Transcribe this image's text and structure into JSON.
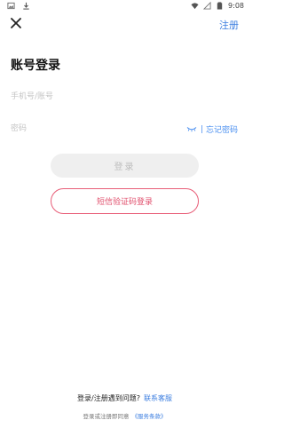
{
  "status_bar": {
    "time": "9:08",
    "left_icons": [
      "image-icon",
      "download-icon"
    ],
    "right_icons": [
      "wifi-icon",
      "signal-icon",
      "battery-icon"
    ]
  },
  "header": {
    "close_icon": "close-icon",
    "register_label": "注册"
  },
  "page": {
    "title": "账号登录"
  },
  "form": {
    "phone_placeholder": "手机号/账号",
    "password_placeholder": "密码",
    "separator": "|",
    "forgot_label": "忘记密码",
    "login_label": "登录",
    "sms_login_label": "短信验证码登录"
  },
  "footer": {
    "help_text": "登录/注册遇到问题?",
    "help_link": "联系客服",
    "terms_text": "登录或注册即同意",
    "terms_link": "《服务条款》"
  },
  "colors": {
    "accent_blue": "#3d7fe0",
    "sms_red": "#e85e78",
    "disabled_bg": "#efefef"
  }
}
